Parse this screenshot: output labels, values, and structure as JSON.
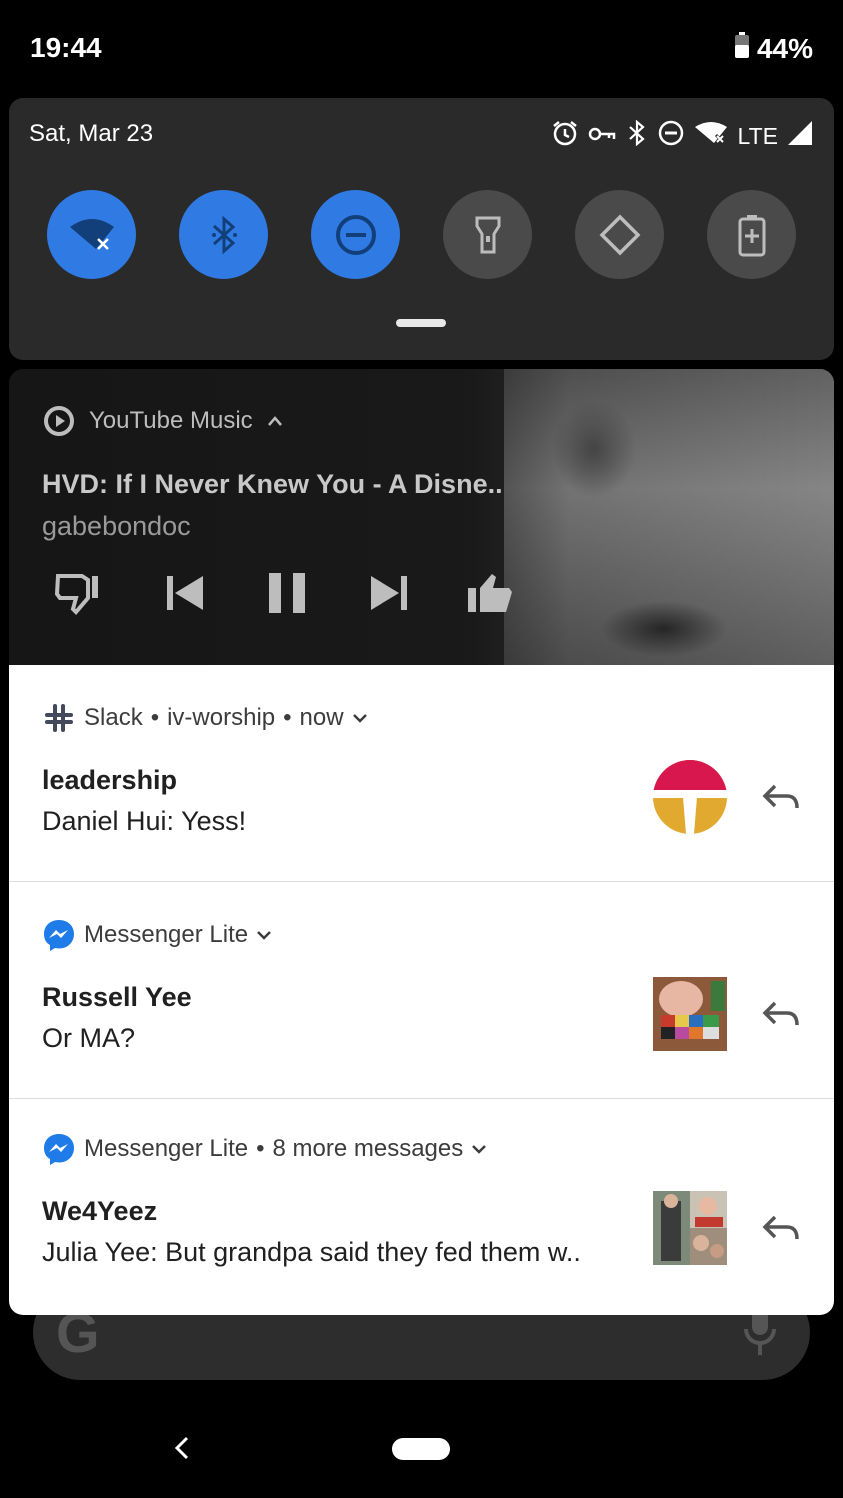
{
  "status_bar": {
    "time": "19:44",
    "battery": "44%"
  },
  "quick_settings": {
    "date": "Sat, Mar 23",
    "network": "LTE",
    "accent_color": "#2f7be3",
    "tiles": [
      {
        "name": "wifi",
        "icon": "wifi-off-icon",
        "state": "on"
      },
      {
        "name": "bluetooth",
        "icon": "bluetooth-icon",
        "state": "on"
      },
      {
        "name": "do-not-disturb",
        "icon": "dnd-icon",
        "state": "on"
      },
      {
        "name": "flashlight",
        "icon": "flashlight-icon",
        "state": "off"
      },
      {
        "name": "auto-rotate",
        "icon": "rotate-icon",
        "state": "off"
      },
      {
        "name": "battery-saver",
        "icon": "battery-saver-icon",
        "state": "off"
      }
    ]
  },
  "media": {
    "app": "YouTube Music",
    "title": "HVD: If I Never Knew You - A Disne..",
    "artist": "gabebondoc"
  },
  "notifications": [
    {
      "app": "Slack",
      "meta": "iv-worship",
      "time": "now",
      "title": "leadership",
      "text": "Daniel Hui: Yess!"
    },
    {
      "app": "Messenger Lite",
      "meta": "",
      "time": "",
      "title": "Russell Yee",
      "text": "Or MA?"
    },
    {
      "app": "Messenger Lite",
      "meta": "8 more messages",
      "time": "",
      "title": "We4Yeez",
      "text": "Julia Yee: But grandpa said they fed them w.."
    }
  ]
}
